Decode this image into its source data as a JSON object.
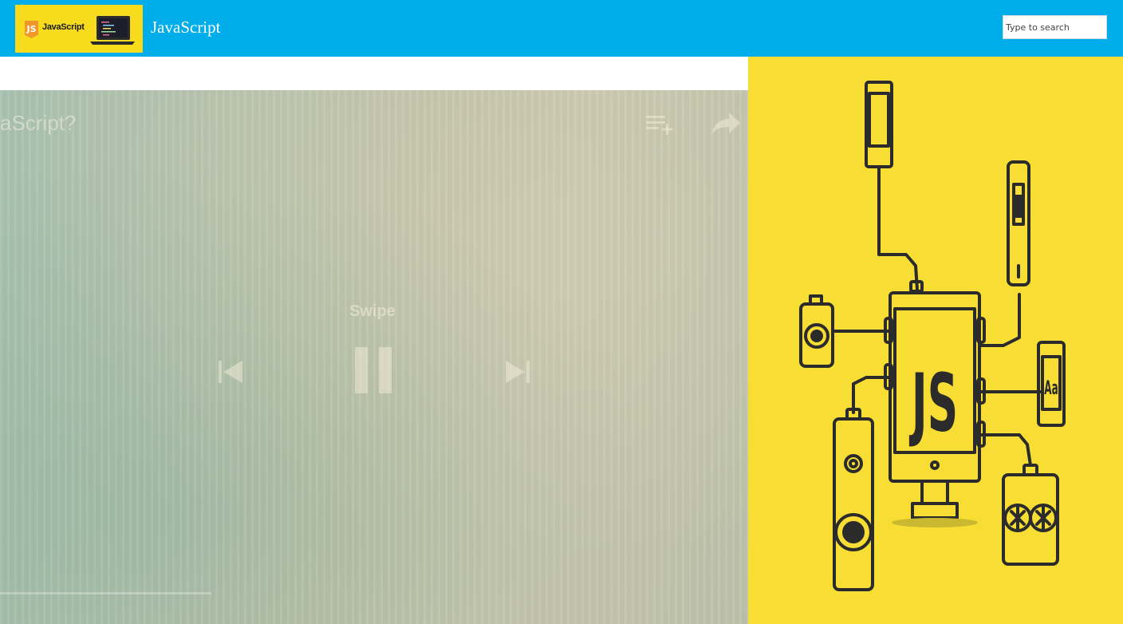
{
  "header": {
    "logo": {
      "badge": "JS",
      "text": "JavaScript"
    },
    "site_title": "JavaScript",
    "search": {
      "placeholder": "Type to search",
      "value": ""
    }
  },
  "video": {
    "title": "aScript?",
    "overlay_label": "Swipe",
    "controls": [
      "playlist-add-icon",
      "share-icon",
      "previous-icon",
      "pause-icon",
      "next-icon"
    ]
  },
  "ad": {
    "center_label": "JS",
    "tablet_label": "Aa"
  },
  "colors": {
    "header_bg": "#00adeb",
    "logo_bg": "#f7dc1e",
    "ad_bg": "#f8de34",
    "outline": "#2b2b2b"
  }
}
